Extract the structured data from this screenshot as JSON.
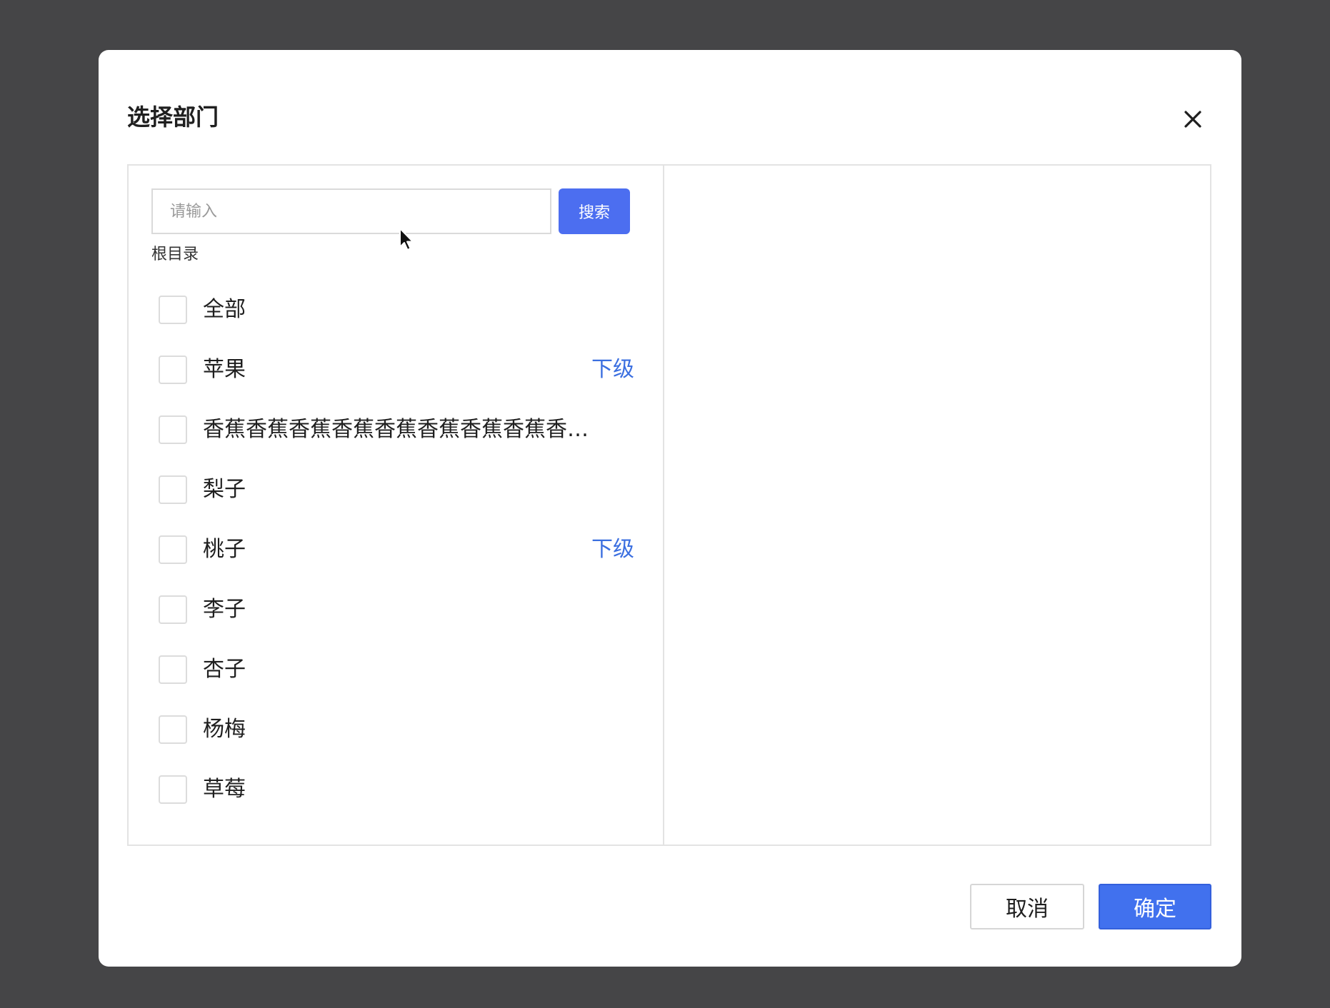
{
  "dialog": {
    "title": "选择部门",
    "close_label": "X"
  },
  "search": {
    "placeholder": "请输入",
    "value": "",
    "button_label": "搜索"
  },
  "breadcrumb": {
    "root_label": "根目录"
  },
  "departments": [
    {
      "label": "全部",
      "checked": false,
      "sub_label": ""
    },
    {
      "label": "苹果",
      "checked": false,
      "sub_label": "下级"
    },
    {
      "label": "香蕉香蕉香蕉香蕉香蕉香蕉香蕉香蕉香…",
      "checked": false,
      "sub_label": ""
    },
    {
      "label": "梨子",
      "checked": false,
      "sub_label": ""
    },
    {
      "label": "桃子",
      "checked": false,
      "sub_label": "下级"
    },
    {
      "label": "李子",
      "checked": false,
      "sub_label": ""
    },
    {
      "label": "杏子",
      "checked": false,
      "sub_label": ""
    },
    {
      "label": "杨梅",
      "checked": false,
      "sub_label": ""
    },
    {
      "label": "草莓",
      "checked": false,
      "sub_label": ""
    }
  ],
  "footer": {
    "cancel_label": "取消",
    "confirm_label": "确定"
  },
  "icons": {
    "close": "close-icon",
    "cursor": "mouse-pointer-icon"
  },
  "colors": {
    "overlay": "#454547",
    "primary": "#4171ee",
    "link": "#3b6fe0",
    "border": "#e3e3e3"
  }
}
